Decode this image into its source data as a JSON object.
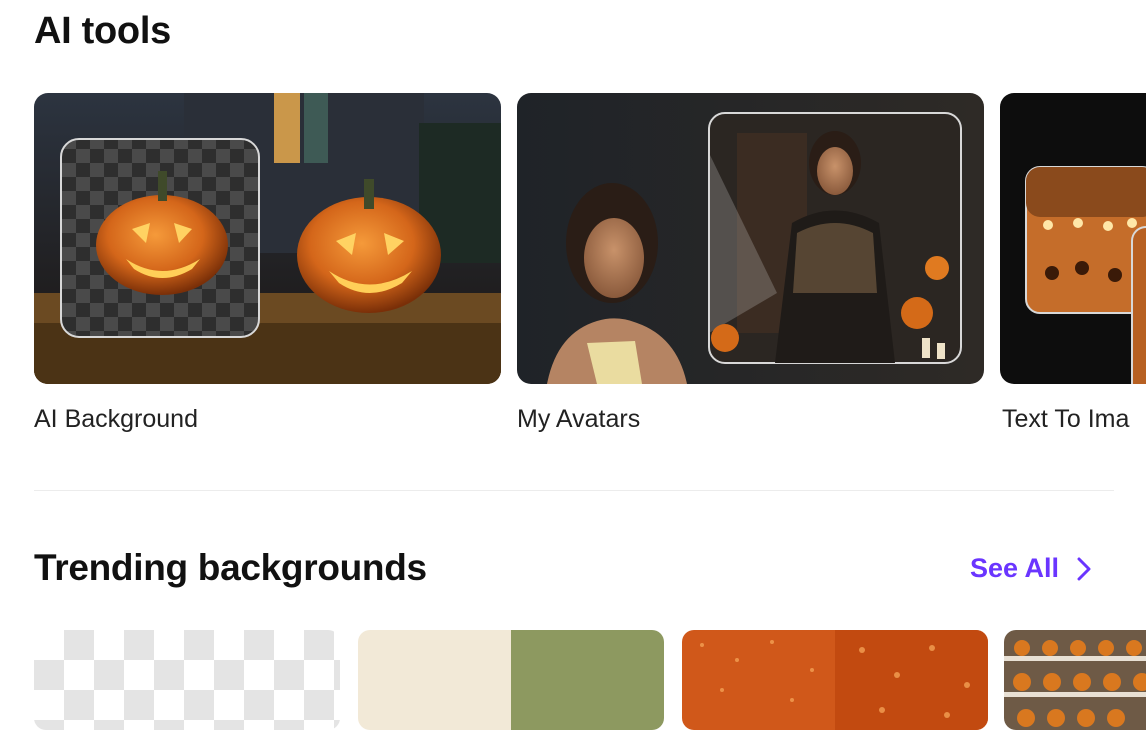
{
  "ai_tools": {
    "title": "AI tools",
    "cards": [
      {
        "label": "AI Background"
      },
      {
        "label": "My Avatars"
      },
      {
        "label": "Text To Ima"
      }
    ]
  },
  "trending": {
    "title": "Trending backgrounds",
    "see_all_label": "See All"
  },
  "colors": {
    "accent": "#6a35ff",
    "heading": "#111111"
  }
}
